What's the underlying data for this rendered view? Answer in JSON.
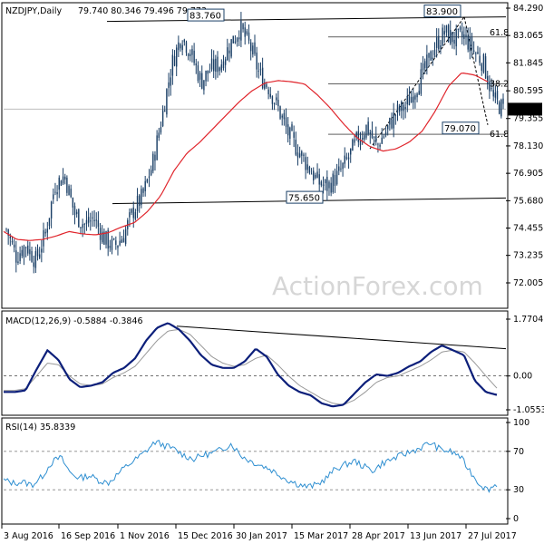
{
  "header": {
    "symbol": "NZDJPY,Daily",
    "ohlc": "79.740 80.346 79.496 79.773"
  },
  "watermark": "ActionForex.com",
  "colors": {
    "candle": "#1a3f66",
    "sma": "#e0242b",
    "trend": "#000000",
    "macd": "#0c1f7a",
    "signal": "#999999",
    "rsi": "#2f8fd1",
    "grid": "#bdbdbd",
    "box_fill": "#ffffff",
    "price_box_fill": "#000000"
  },
  "chart_data": [
    {
      "type": "candlestick",
      "title": "NZDJPY,Daily 79.740 80.346 79.496 79.773",
      "ylim": [
        72.005,
        84.29
      ],
      "y_ticks": [
        "84.290",
        "83.065",
        "81.845",
        "80.595",
        "79.355",
        "78.130",
        "76.905",
        "75.680",
        "74.455",
        "73.235",
        "72.005"
      ],
      "current_price": "79.773",
      "annotations": [
        {
          "text": "83.760"
        },
        {
          "text": "83.900"
        },
        {
          "text": "75.650"
        },
        {
          "text": "79.070"
        },
        {
          "text": "61.8"
        },
        {
          "text": "38.2"
        },
        {
          "text": "61.8"
        }
      ],
      "close_path": [
        74.4,
        73.2,
        73.7,
        73.0,
        74.2,
        76.4,
        76.8,
        75.1,
        74.6,
        74.9,
        74.0,
        73.6,
        74.1,
        75.2,
        75.9,
        77.3,
        79.5,
        81.8,
        83.1,
        82.2,
        81.0,
        81.6,
        81.8,
        82.7,
        83.4,
        82.6,
        81.3,
        80.7,
        79.7,
        78.6,
        77.9,
        77.2,
        76.5,
        76.3,
        76.8,
        77.5,
        78.4,
        79.0,
        78.1,
        78.8,
        79.6,
        79.9,
        80.7,
        81.6,
        82.6,
        83.2,
        82.9,
        83.0,
        82.4,
        81.8,
        80.2,
        79.77
      ],
      "sma_path": [
        74.3,
        73.95,
        73.9,
        73.95,
        74.1,
        74.3,
        74.2,
        74.15,
        74.25,
        74.5,
        74.7,
        75.2,
        75.9,
        77.0,
        77.8,
        78.3,
        78.9,
        79.5,
        80.1,
        80.6,
        80.95,
        81.05,
        81.0,
        80.9,
        80.4,
        79.8,
        79.1,
        78.5,
        78.1,
        77.9,
        78.0,
        78.3,
        78.8,
        79.7,
        80.8,
        81.4,
        81.3,
        81.0
      ],
      "trend_lines": [
        {
          "name": "resistance",
          "from": 83.9,
          "to": 83.9
        },
        {
          "name": "support",
          "from": 75.55,
          "to": 75.8
        }
      ]
    },
    {
      "type": "line",
      "title": "MACD(12,26,9) -0.5884 -0.3846",
      "ylim": [
        -1.0553,
        1.7704
      ],
      "y_ticks": [
        "1.7704",
        "0.00",
        "-1.0553"
      ],
      "series": [
        {
          "values": [
            -0.5,
            -0.5,
            -0.45,
            0.2,
            0.8,
            0.5,
            -0.1,
            -0.35,
            -0.3,
            -0.2,
            0.1,
            0.25,
            0.55,
            1.1,
            1.5,
            1.65,
            1.45,
            1.1,
            0.65,
            0.35,
            0.25,
            0.25,
            0.45,
            0.85,
            0.6,
            0.05,
            -0.3,
            -0.5,
            -0.6,
            -0.85,
            -0.95,
            -0.9,
            -0.55,
            -0.2,
            0.05,
            0.0,
            0.1,
            0.3,
            0.45,
            0.75,
            0.95,
            0.8,
            0.65,
            -0.15,
            -0.5,
            -0.59
          ]
        },
        {
          "values": [
            -0.45,
            -0.45,
            -0.4,
            0.0,
            0.4,
            0.35,
            0.0,
            -0.25,
            -0.3,
            -0.25,
            -0.05,
            0.1,
            0.3,
            0.7,
            1.1,
            1.4,
            1.45,
            1.3,
            0.95,
            0.6,
            0.4,
            0.3,
            0.35,
            0.55,
            0.65,
            0.35,
            0.0,
            -0.3,
            -0.5,
            -0.7,
            -0.85,
            -0.9,
            -0.75,
            -0.5,
            -0.2,
            -0.05,
            0.0,
            0.15,
            0.3,
            0.5,
            0.75,
            0.8,
            0.75,
            0.4,
            0.0,
            -0.38
          ]
        }
      ],
      "trend_line": {
        "from": 1.55,
        "to": 0.85
      }
    },
    {
      "type": "line",
      "title": "RSI(14) 35.8339",
      "ylim": [
        0,
        100
      ],
      "y_ticks": [
        "100",
        "70",
        "30",
        "0"
      ],
      "reference_levels": [
        70,
        30
      ],
      "values": [
        40,
        37,
        38,
        35,
        43,
        58,
        64,
        48,
        42,
        45,
        40,
        37,
        46,
        55,
        62,
        70,
        80,
        76,
        72,
        66,
        62,
        66,
        68,
        72,
        78,
        66,
        60,
        56,
        52,
        46,
        40,
        36,
        33,
        35,
        42,
        52,
        56,
        60,
        54,
        50,
        58,
        62,
        66,
        70,
        74,
        79,
        72,
        70,
        66,
        52,
        38,
        30,
        36
      ]
    }
  ],
  "x_axis": {
    "labels": [
      "3 Aug 2016",
      "16 Sep 2016",
      "1 Nov 2016",
      "15 Dec 2016",
      "30 Jan 2017",
      "15 Mar 2017",
      "28 Apr 2017",
      "13 Jun 2017",
      "27 Jul 2017"
    ]
  }
}
